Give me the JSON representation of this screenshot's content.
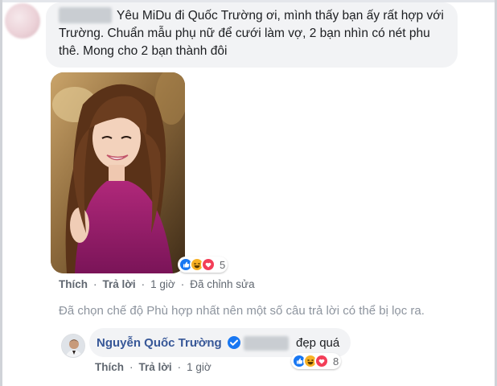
{
  "comment": {
    "author_redacted": true,
    "text": "Yêu MiDu đi Quốc Trường ơi, mình thấy bạn ấy rất hợp với Trường. Chuẩn mẫu phụ nữ để cưới làm vợ, 2 bạn nhìn có nét phu thê. Mong cho 2 bạn thành đôi",
    "photo_icon": "portrait-photo",
    "reactions": {
      "icons": [
        "like-icon",
        "haha-icon",
        "love-icon"
      ],
      "count": "5"
    },
    "actions": {
      "like": "Thích",
      "reply": "Trả lời",
      "time": "1 giờ",
      "edited": "Đã chỉnh sửa"
    }
  },
  "filter_notice": "Đã chọn chế độ Phù hợp nhất nên một số câu trả lời có thể bị lọc ra.",
  "reply": {
    "author": "Nguyễn Quốc Trường",
    "verified_icon": "verified-badge-icon",
    "text": "đẹp quá",
    "reactions": {
      "icons": [
        "like-icon",
        "haha-icon",
        "love-icon"
      ],
      "count": "8"
    },
    "actions": {
      "like": "Thích",
      "reply": "Trả lời",
      "time": "1 giờ"
    }
  },
  "colors": {
    "bubble": "#f2f3f5",
    "author_link": "#385898",
    "meta": "#606770",
    "notice": "#8d949e",
    "like": "#1877f2",
    "love": "#f33e58",
    "haha": "#f7b125"
  }
}
